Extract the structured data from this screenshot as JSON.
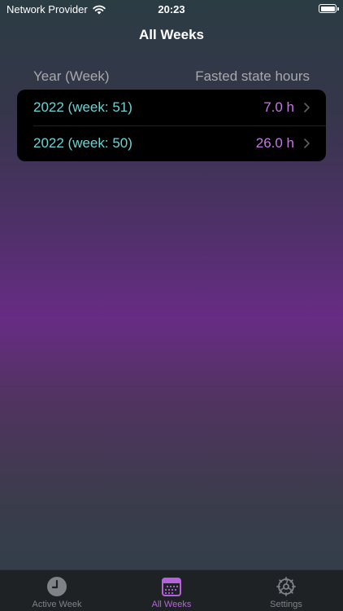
{
  "status_bar": {
    "carrier": "Network Provider",
    "time": "20:23",
    "battery_level": 1.0
  },
  "nav": {
    "title": "All Weeks"
  },
  "table": {
    "headers": {
      "year_week": "Year (Week)",
      "fasted_hours": "Fasted state hours"
    },
    "rows": [
      {
        "label": "2022 (week: 51)",
        "value": "7.0 h"
      },
      {
        "label": "2022 (week: 50)",
        "value": "26.0 h"
      }
    ]
  },
  "tab_bar": {
    "tabs": [
      {
        "label": "Active Week",
        "icon": "clock-icon",
        "active": false
      },
      {
        "label": "All Weeks",
        "icon": "calendar-icon",
        "active": true
      },
      {
        "label": "Settings",
        "icon": "gear-icon",
        "active": false
      }
    ]
  },
  "colors": {
    "accent": "#b563dc",
    "row_label": "#6ed2d2",
    "row_value": "#c27ae0"
  }
}
